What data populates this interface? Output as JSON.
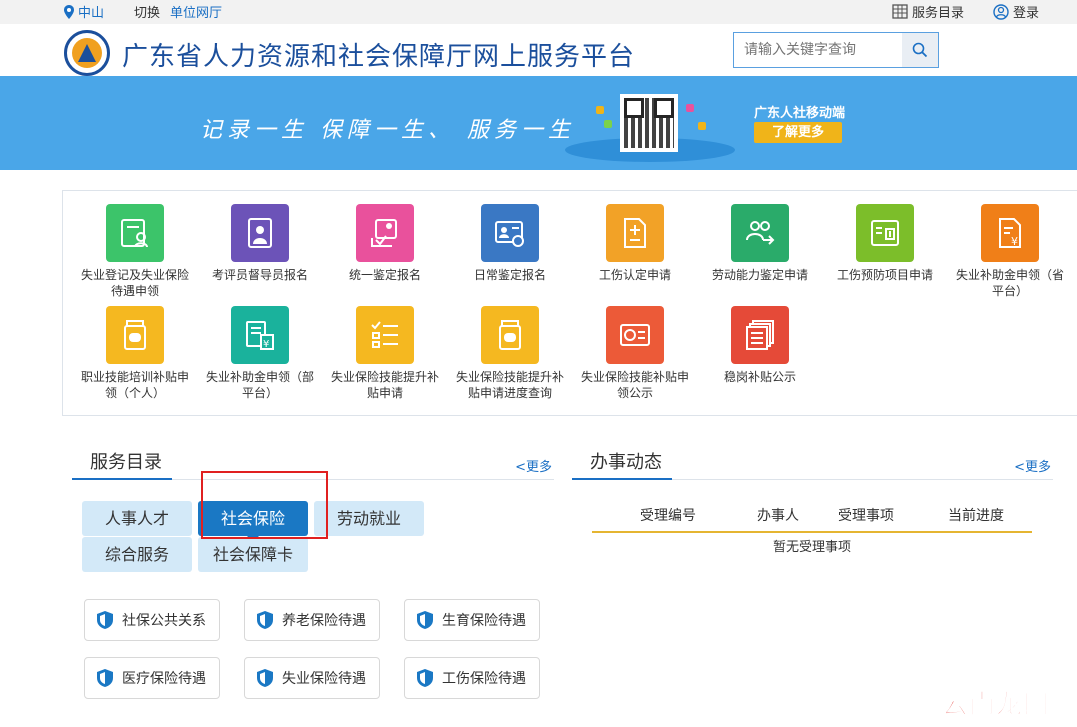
{
  "topbar": {
    "city": "中山",
    "switch_label": "切换",
    "switch_link": "单位网厅",
    "service_catalog": "服务目录",
    "login": "登录"
  },
  "header": {
    "title": "广东省人力资源和社会保障厅网上服务平台",
    "search_placeholder": "请输入关键字查询"
  },
  "banner": {
    "slogan": "记录一生  保障一生、  服务一生",
    "mobile_label": "广东人社移动端",
    "more_button": "了解更多"
  },
  "services": [
    {
      "label": "失业登记及失业保险待遇申领",
      "color": "#3cc46a",
      "icon": "registration-icon"
    },
    {
      "label": "考评员督导员报名",
      "color": "#6c53b8",
      "icon": "examiner-icon"
    },
    {
      "label": "统一鉴定报名",
      "color": "#e9519c",
      "icon": "appraisal-icon"
    },
    {
      "label": "日常鉴定报名",
      "color": "#3a78c4",
      "icon": "id-card-icon"
    },
    {
      "label": "工伤认定申请",
      "color": "#f2a227",
      "icon": "document-add-icon"
    },
    {
      "label": "劳动能力鉴定申请",
      "color": "#2aab6a",
      "icon": "people-exchange-icon"
    },
    {
      "label": "工伤预防项目申请",
      "color": "#7cbe2a",
      "icon": "medical-board-icon"
    },
    {
      "label": "失业补助金申领（省平台）",
      "color": "#f07f18",
      "icon": "yuan-document-icon"
    },
    {
      "label": "职业技能培训补贴申领（个人）",
      "color": "#f5b820",
      "icon": "pill-bottle-icon"
    },
    {
      "label": "失业补助金申领（部平台）",
      "color": "#1ab29c",
      "icon": "yuan-list-icon"
    },
    {
      "label": "失业保险技能提升补贴申请",
      "color": "#f5b820",
      "icon": "checklist-icon"
    },
    {
      "label": "失业保险技能提升补贴申请进度查询",
      "color": "#f5b820",
      "icon": "pill-bottle-icon"
    },
    {
      "label": "失业保险技能补贴申领公示",
      "color": "#ec5a38",
      "icon": "card-icon"
    },
    {
      "label": "稳岗补贴公示",
      "color": "#e54a38",
      "icon": "stacked-docs-icon"
    }
  ],
  "catalog": {
    "title": "服务目录",
    "more": "<更多",
    "tabs": [
      "人事人才",
      "社会保险",
      "劳动就业",
      "综合服务",
      "社会保障卡"
    ],
    "active_tab": "社会保险",
    "items": [
      "社保公共关系",
      "养老保险待遇",
      "生育保险待遇",
      "医疗保险待遇",
      "失业保险待遇",
      "工伤保险待遇"
    ]
  },
  "news": {
    "title": "办事动态",
    "more": "<更多",
    "columns": [
      "受理编号",
      "办事人",
      "受理事项",
      "当前进度"
    ],
    "empty": "暂无受理事项"
  },
  "watermark": "云南龙网"
}
